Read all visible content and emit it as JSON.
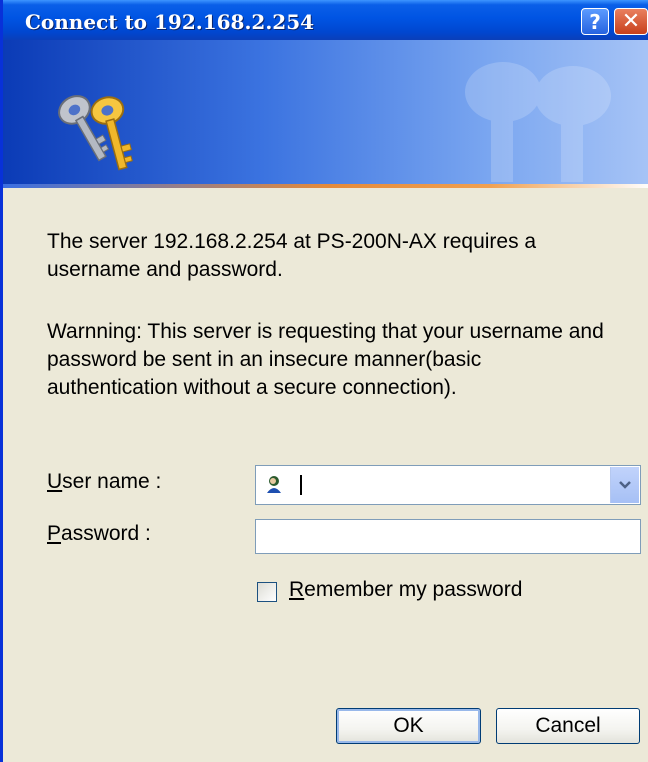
{
  "window": {
    "title": "Connect to 192.168.2.254"
  },
  "message": {
    "line1": "The server 192.168.2.254 at PS-200N-AX requires a username and password.",
    "line2": "Warnning: This server is requesting that your username and password be sent in an insecure manner(basic authentication without a secure connection)."
  },
  "form": {
    "username_label_accel": "U",
    "username_label_rest": "ser name :",
    "username_value": "",
    "password_label_accel": "P",
    "password_label_rest": "assword :",
    "password_value": "",
    "remember_accel": "R",
    "remember_rest": "emember my password",
    "remember_checked": false
  },
  "buttons": {
    "ok": "OK",
    "cancel": "Cancel",
    "help": "?",
    "close": "✕"
  },
  "icons": {
    "banner": "keys-icon",
    "user": "user-avatar-icon",
    "dropdown": "chevron-down-icon"
  },
  "colors": {
    "titlebar": "#0054e3",
    "dialog_bg": "#ece9d8",
    "close": "#c8401c"
  }
}
